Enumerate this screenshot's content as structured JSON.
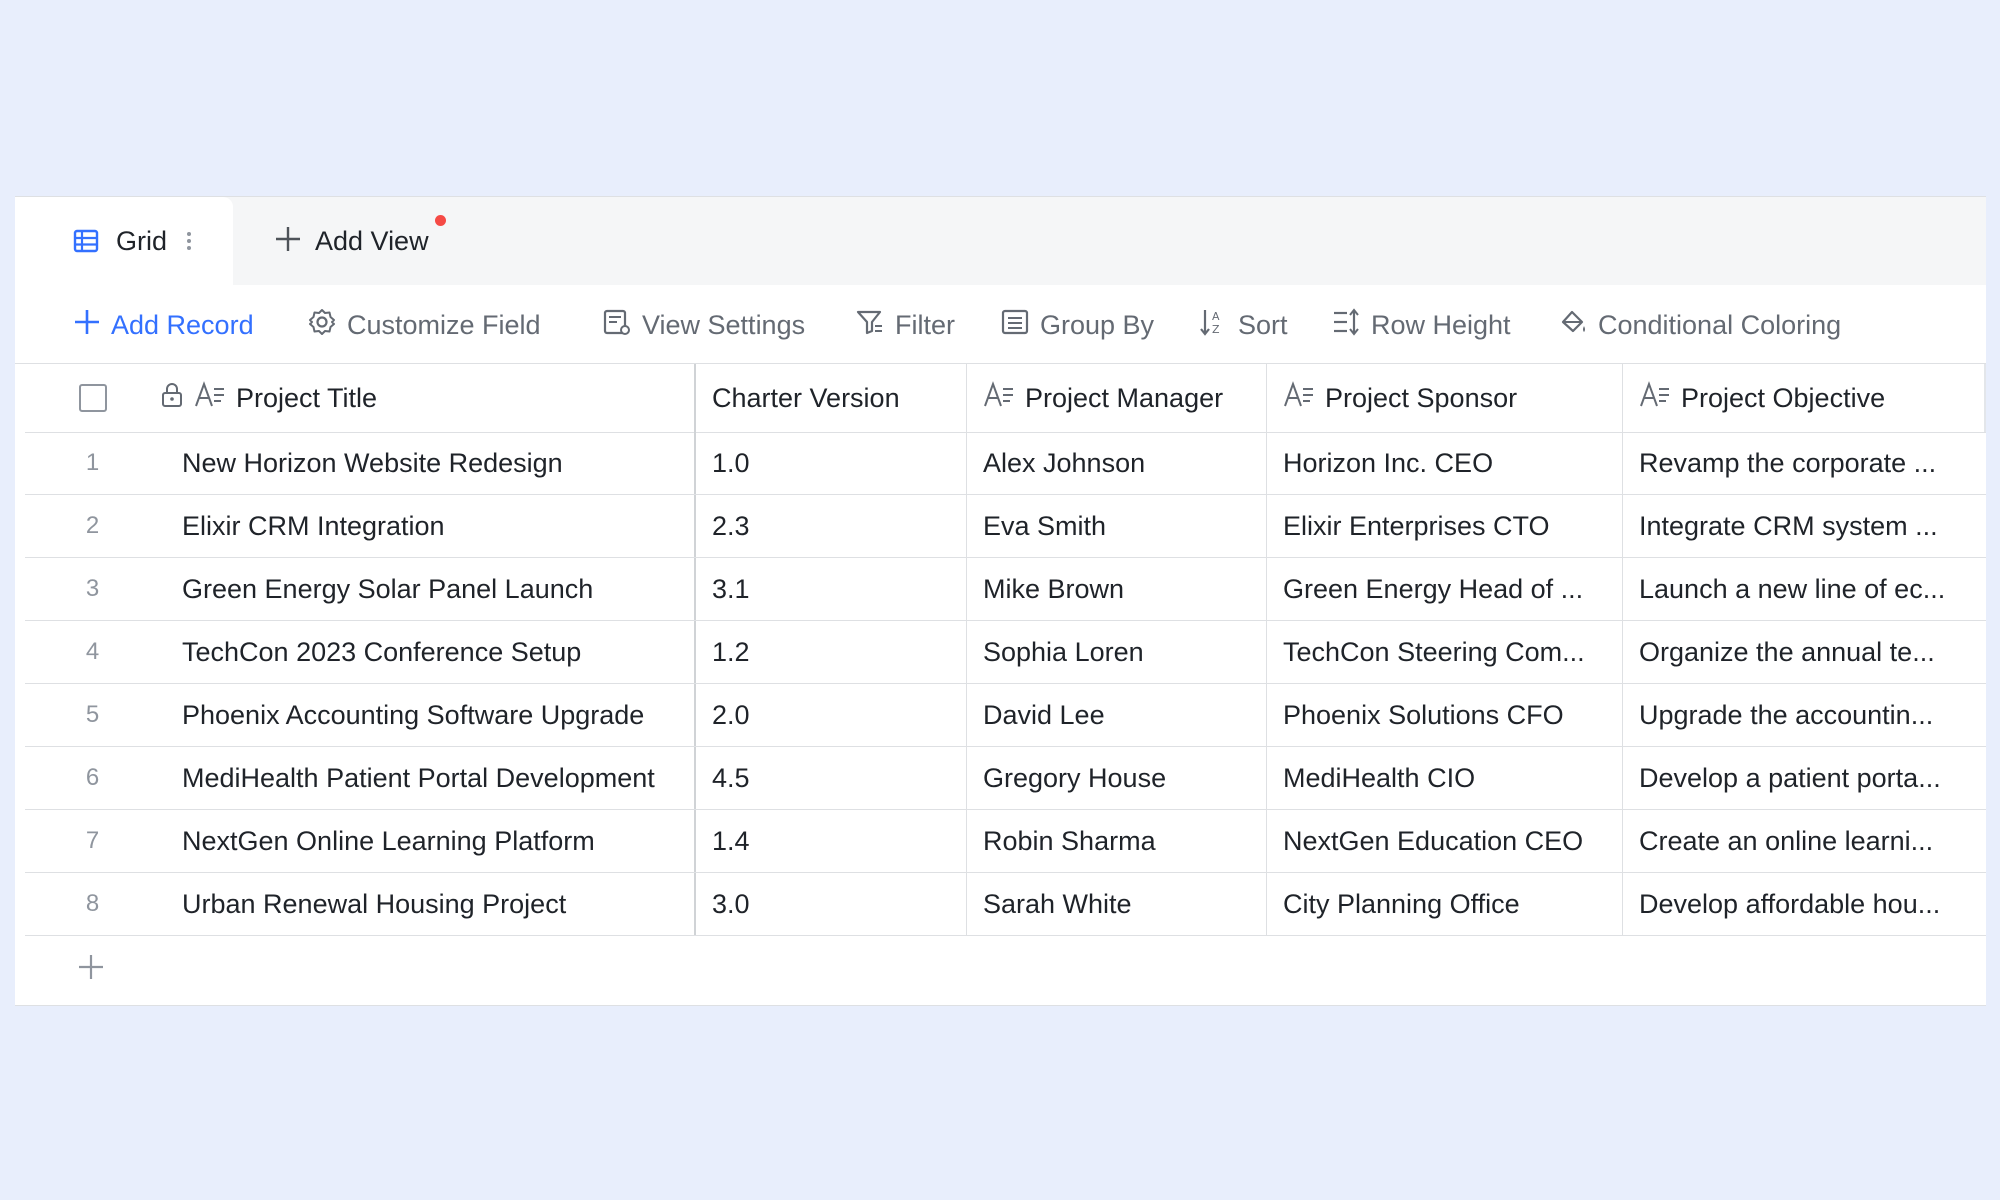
{
  "tabs": {
    "active_label": "Grid",
    "add_view_label": "Add View"
  },
  "toolbar": {
    "add_record": "Add Record",
    "customize_field": "Customize Field",
    "view_settings": "View Settings",
    "filter": "Filter",
    "group_by": "Group By",
    "sort": "Sort",
    "row_height": "Row Height",
    "conditional_coloring": "Conditional Coloring"
  },
  "columns": {
    "title": "Project Title",
    "charter": "Charter Version",
    "manager": "Project Manager",
    "sponsor": "Project Sponsor",
    "objective": "Project Objective"
  },
  "rows": [
    {
      "num": "1",
      "title": "New Horizon Website Redesign",
      "charter": "1.0",
      "manager": "Alex Johnson",
      "sponsor": "Horizon Inc. CEO",
      "objective": "Revamp the corporate ..."
    },
    {
      "num": "2",
      "title": "Elixir CRM Integration",
      "charter": "2.3",
      "manager": "Eva Smith",
      "sponsor": "Elixir Enterprises CTO",
      "objective": "Integrate CRM system ..."
    },
    {
      "num": "3",
      "title": "Green Energy Solar Panel Launch",
      "charter": "3.1",
      "manager": "Mike Brown",
      "sponsor": "Green Energy Head of ...",
      "objective": "Launch a new line of ec..."
    },
    {
      "num": "4",
      "title": "TechCon 2023 Conference Setup",
      "charter": "1.2",
      "manager": "Sophia Loren",
      "sponsor": "TechCon Steering Com...",
      "objective": "Organize the annual te..."
    },
    {
      "num": "5",
      "title": "Phoenix Accounting Software Upgrade",
      "charter": "2.0",
      "manager": "David Lee",
      "sponsor": "Phoenix Solutions CFO",
      "objective": "Upgrade the accountin..."
    },
    {
      "num": "6",
      "title": "MediHealth Patient Portal Development",
      "charter": "4.5",
      "manager": "Gregory House",
      "sponsor": "MediHealth CIO",
      "objective": "Develop a patient porta..."
    },
    {
      "num": "7",
      "title": "NextGen Online Learning Platform",
      "charter": "1.4",
      "manager": "Robin Sharma",
      "sponsor": "NextGen Education CEO",
      "objective": "Create an online learni..."
    },
    {
      "num": "8",
      "title": "Urban Renewal Housing Project",
      "charter": "3.0",
      "manager": "Sarah White",
      "sponsor": "City Planning Office",
      "objective": "Develop affordable hou..."
    }
  ],
  "colors": {
    "accent": "#3370ff",
    "background": "#e8eefc",
    "notification_dot": "#f54a45"
  }
}
